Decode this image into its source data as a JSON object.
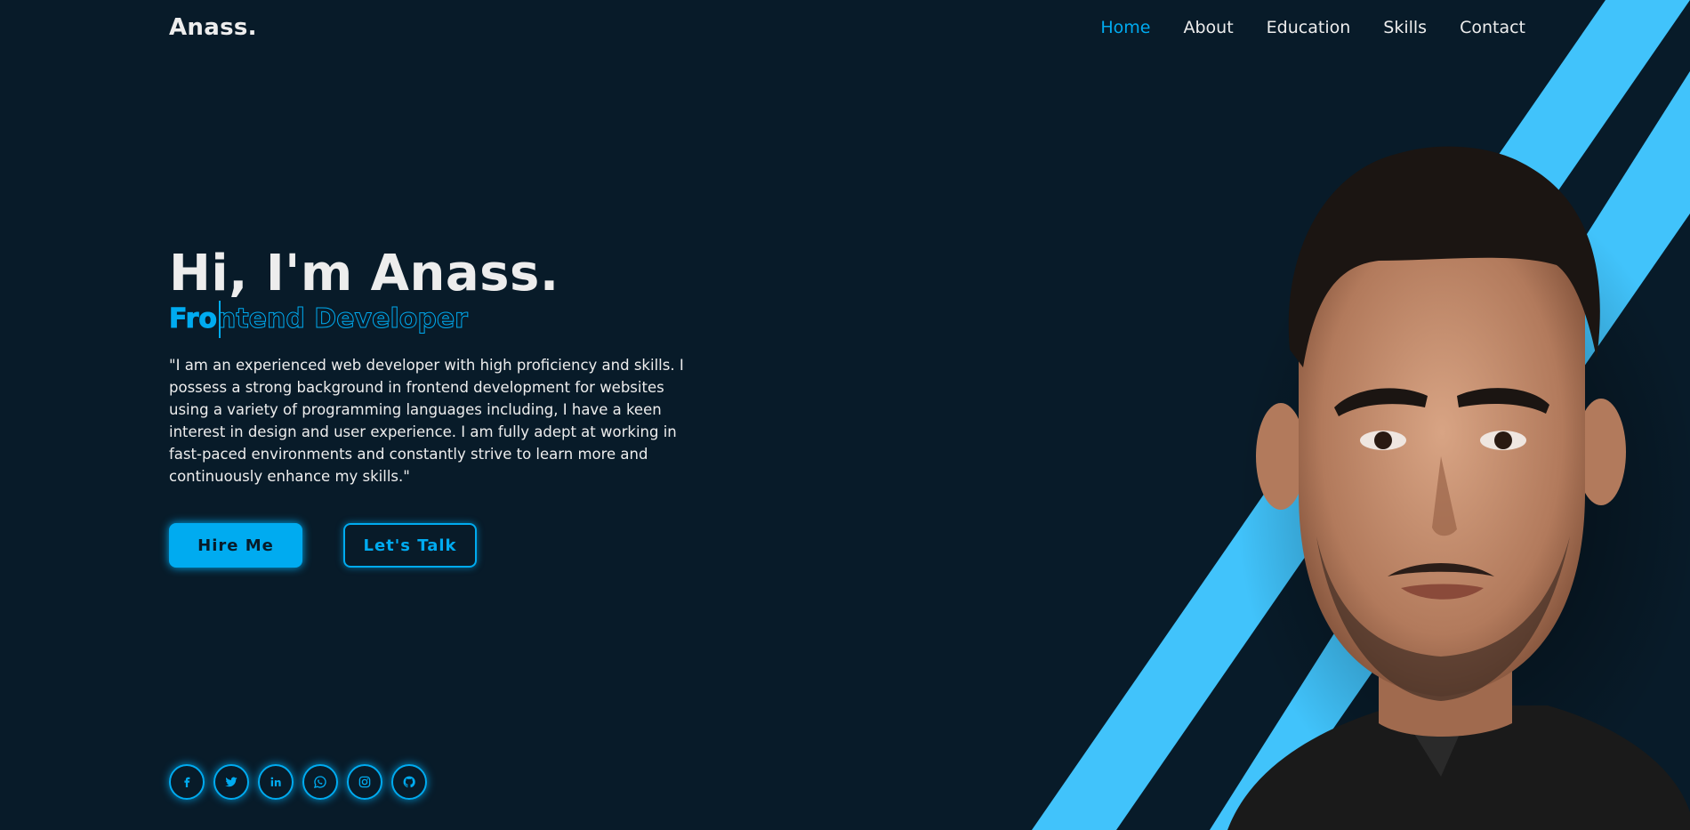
{
  "header": {
    "logo": "Anass.",
    "nav": [
      {
        "label": "Home",
        "active": true
      },
      {
        "label": "About",
        "active": false
      },
      {
        "label": "Education",
        "active": false
      },
      {
        "label": "Skills",
        "active": false
      },
      {
        "label": "Contact",
        "active": false
      }
    ]
  },
  "hero": {
    "title": "Hi, I'm Anass.",
    "role": "Frontend Developer",
    "role_typed_part": "Fro",
    "description": "\"I am an experienced web developer with high proficiency and skills. I possess a strong background in frontend development for websites using a variety of programming languages including, I have a keen interest in design and user experience. I am fully adept at working in fast-paced environments and constantly strive to learn more and continuously enhance my skills.\"",
    "buttons": {
      "hire": "Hire Me",
      "talk": "Let's Talk"
    }
  },
  "social": [
    {
      "icon": "facebook-icon"
    },
    {
      "icon": "twitter-icon"
    },
    {
      "icon": "linkedin-icon"
    },
    {
      "icon": "whatsapp-icon"
    },
    {
      "icon": "instagram-icon"
    },
    {
      "icon": "github-icon"
    }
  ],
  "colors": {
    "background": "#081b29",
    "accent": "#00abf0",
    "stripe": "#41c3fb",
    "text": "#ededed"
  }
}
